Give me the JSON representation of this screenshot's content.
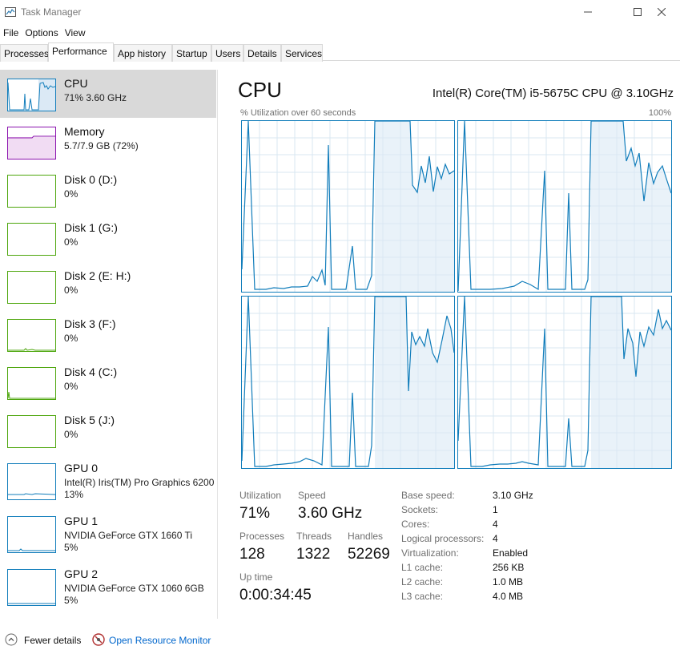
{
  "window": {
    "title": "Task Manager",
    "icons": {
      "app": "task-manager-icon",
      "minimize": "minimize-icon",
      "maximize": "maximize-icon",
      "close": "close-icon"
    }
  },
  "menu": [
    "File",
    "Options",
    "View"
  ],
  "tabs": [
    "Processes",
    "Performance",
    "App history",
    "Startup",
    "Users",
    "Details",
    "Services"
  ],
  "active_tab": "Performance",
  "sidebar": [
    {
      "title": "CPU",
      "line1": "71%  3.60 GHz",
      "line2": "",
      "color": "#117dbb",
      "selected": true
    },
    {
      "title": "Memory",
      "line1": "5.7/7.9 GB (72%)",
      "line2": "",
      "color": "#8b12ae",
      "selected": false
    },
    {
      "title": "Disk 0 (D:)",
      "line1": "0%",
      "line2": "",
      "color": "#4da60c",
      "selected": false
    },
    {
      "title": "Disk 1 (G:)",
      "line1": "0%",
      "line2": "",
      "color": "#4da60c",
      "selected": false
    },
    {
      "title": "Disk 2 (E: H:)",
      "line1": "0%",
      "line2": "",
      "color": "#4da60c",
      "selected": false
    },
    {
      "title": "Disk 3 (F:)",
      "line1": "0%",
      "line2": "",
      "color": "#4da60c",
      "selected": false
    },
    {
      "title": "Disk 4 (C:)",
      "line1": "0%",
      "line2": "",
      "color": "#4da60c",
      "selected": false
    },
    {
      "title": "Disk 5 (J:)",
      "line1": "0%",
      "line2": "",
      "color": "#4da60c",
      "selected": false
    },
    {
      "title": "GPU 0",
      "line1": "Intel(R) Iris(TM) Pro Graphics 6200",
      "line2": "13%",
      "color": "#117dbb",
      "selected": false
    },
    {
      "title": "GPU 1",
      "line1": "NVIDIA GeForce GTX 1660 Ti",
      "line2": "5%",
      "color": "#117dbb",
      "selected": false
    },
    {
      "title": "GPU 2",
      "line1": "NVIDIA GeForce GTX 1060 6GB",
      "line2": "5%",
      "color": "#117dbb",
      "selected": false
    }
  ],
  "main": {
    "heading": "CPU",
    "model": "Intel(R) Core(TM) i5-5675C CPU @ 3.10GHz",
    "graph_label": "% Utilization over 60 seconds",
    "graph_max": "100%",
    "stats": {
      "utilization_label": "Utilization",
      "utilization": "71%",
      "speed_label": "Speed",
      "speed": "3.60 GHz",
      "processes_label": "Processes",
      "processes": "128",
      "threads_label": "Threads",
      "threads": "1322",
      "handles_label": "Handles",
      "handles": "52269",
      "uptime_label": "Up time",
      "uptime": "0:00:34:45"
    },
    "details": [
      {
        "label": "Base speed:",
        "value": "3.10 GHz"
      },
      {
        "label": "Sockets:",
        "value": "1"
      },
      {
        "label": "Cores:",
        "value": "4"
      },
      {
        "label": "Logical processors:",
        "value": "4"
      },
      {
        "label": "Virtualization:",
        "value": "Enabled"
      },
      {
        "label": "L1 cache:",
        "value": "256 KB"
      },
      {
        "label": "L2 cache:",
        "value": "1.0 MB"
      },
      {
        "label": "L3 cache:",
        "value": "4.0 MB"
      }
    ]
  },
  "footer": {
    "fewer_details": "Fewer details",
    "resource_monitor": "Open Resource Monitor"
  },
  "colors": {
    "cpu": "#117dbb",
    "memory": "#8b12ae",
    "disk": "#4da60c",
    "link": "#0066cc"
  }
}
